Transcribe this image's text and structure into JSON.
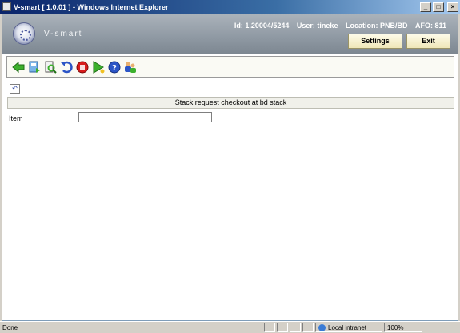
{
  "window": {
    "title": "V-smart [ 1.0.01 ] - Windows Internet Explorer",
    "controls": [
      "_",
      "□",
      "×"
    ]
  },
  "header": {
    "logo_text": "V-smart",
    "id_text": "Id: 1.20004/5244",
    "user_text": "User: tineke",
    "location_text": "Location: PNB/BD",
    "afo_text": "AFO: 811",
    "settings_label": "Settings",
    "exit_label": "Exit"
  },
  "toolbar": {
    "icons": [
      "back-arrow-icon",
      "record-icon",
      "view-icon",
      "undo-icon",
      "stop-icon",
      "play-icon",
      "help-icon",
      "users-icon"
    ]
  },
  "main": {
    "small_button": "↶",
    "title": "Stack request checkout at bd stack",
    "item_label": "Item",
    "item_value": ""
  },
  "statusbar": {
    "status": "Done",
    "zone": "Local intranet",
    "zoom": "100%"
  },
  "colors": {
    "header_gray": "#8e98a2",
    "titlebar_blue": "#0a246a",
    "button_cream": "#efe7b8"
  }
}
